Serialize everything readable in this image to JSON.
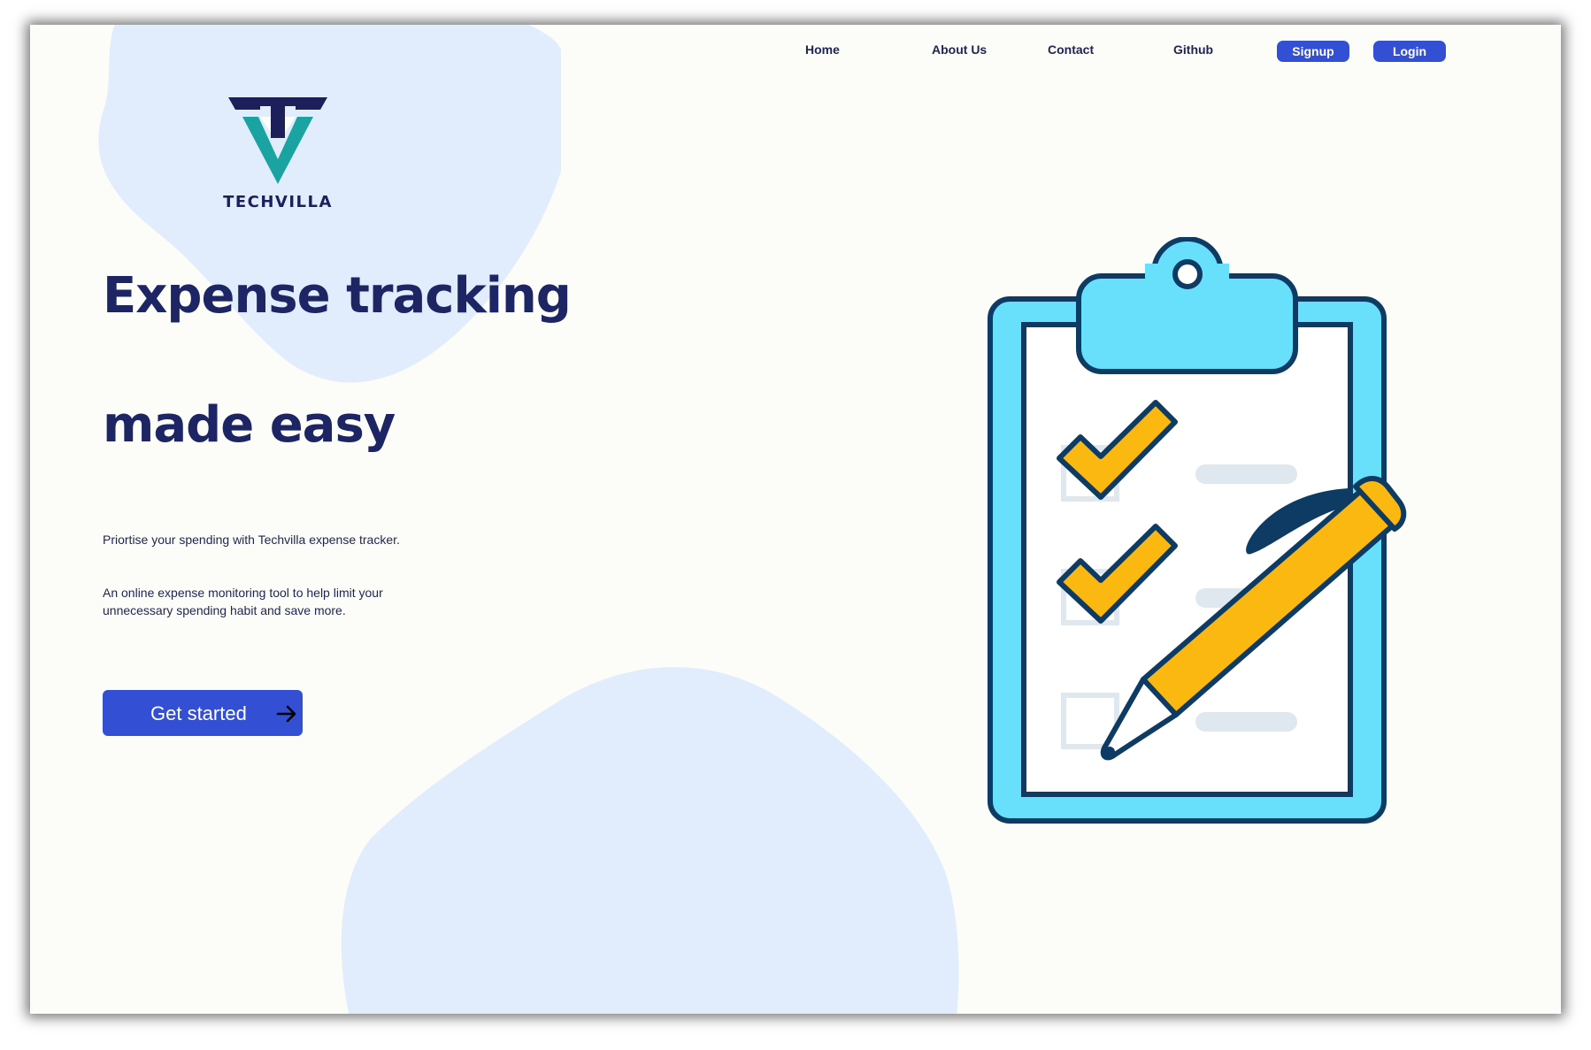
{
  "nav": {
    "links": [
      "Home",
      "About Us",
      "Contact",
      "Github"
    ],
    "signup_label": "Signup",
    "login_label": "Login"
  },
  "logo": {
    "text": "TECHVILLA",
    "icon": "tv-triangle-logo"
  },
  "hero": {
    "headline_line1": "Expense tracking",
    "headline_line2": "made easy",
    "paragraph1": "Priortise your spending with Techvilla expense tracker.",
    "paragraph2": "An online expense monitoring tool to help limit your unnecessary spending habit and save more.",
    "cta_label": "Get started",
    "cta_icon": "arrow-right-icon"
  },
  "illustration": {
    "icon": "clipboard-checklist-with-pen",
    "checked_items": 2,
    "total_items": 3
  },
  "colors": {
    "accent": "#334fd4",
    "heading": "#1d2564",
    "blob": "#e1edfd",
    "clipboard": "#68dffb",
    "outline": "#0e3b63",
    "check": "#fbb810",
    "logo_teal": "#1aa3a0",
    "logo_navy": "#1d1f5a"
  }
}
